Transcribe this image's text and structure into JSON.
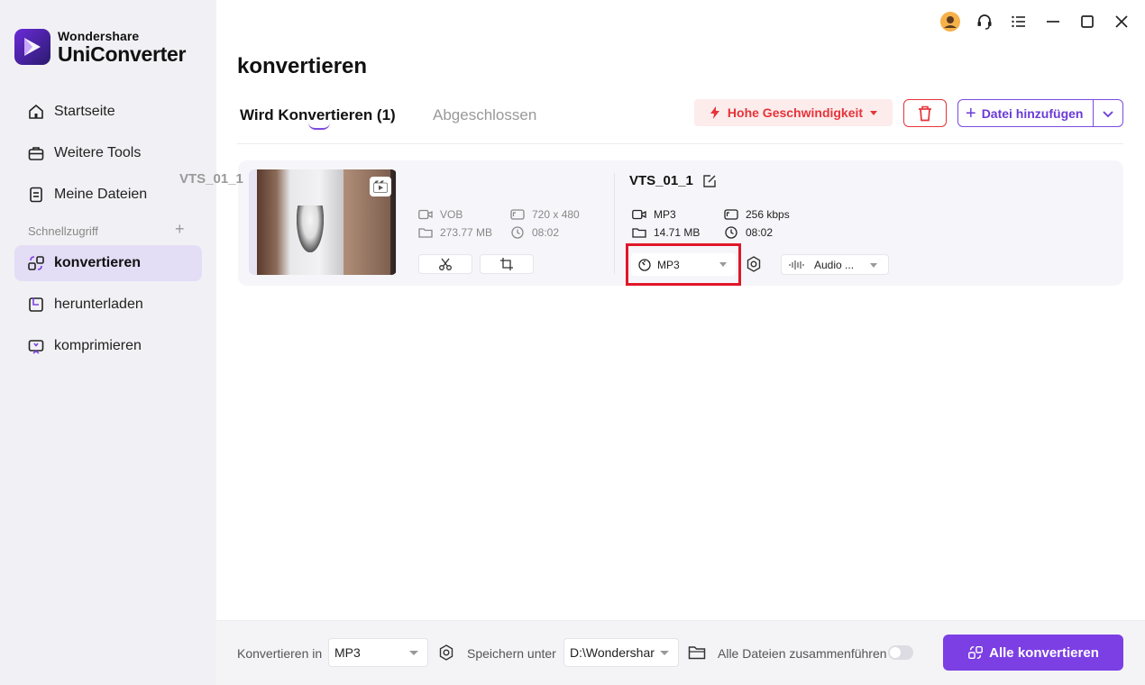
{
  "app": {
    "brand": "Wondershare",
    "product": "UniConverter"
  },
  "sidebar": {
    "items": [
      {
        "label": "Startseite",
        "icon": "home-icon"
      },
      {
        "label": "Weitere Tools",
        "icon": "toolbox-icon"
      },
      {
        "label": "Meine Dateien",
        "icon": "file-icon"
      }
    ],
    "section_label": "Schnellzugriff",
    "quick_items": [
      {
        "label": "konvertieren",
        "icon": "convert-icon",
        "active": true
      },
      {
        "label": "herunterladen",
        "icon": "download-icon"
      },
      {
        "label": "komprimieren",
        "icon": "compress-icon"
      }
    ]
  },
  "main": {
    "title": "konvertieren",
    "tabs": [
      {
        "label": "Wird Konvertieren (1)",
        "active": true
      },
      {
        "label": "Abgeschlossen",
        "active": false
      }
    ],
    "speed_label": "Hohe Geschwindigkeit",
    "add_file_label": "Datei hinzufügen"
  },
  "file": {
    "source": {
      "name": "VTS_01_1",
      "format": "VOB",
      "size": "273.77 MB",
      "resolution": "720 x 480",
      "duration": "08:02"
    },
    "output": {
      "name": "VTS_01_1",
      "format": "MP3",
      "size": "14.71 MB",
      "bitrate": "256 kbps",
      "duration": "08:02",
      "format_select": "MP3",
      "audio_select": "Audio ..."
    }
  },
  "bottom": {
    "convert_in_label": "Konvertieren in",
    "convert_in_value": "MP3",
    "save_label": "Speichern unter",
    "save_path": "D:\\Wondershar",
    "merge_label": "Alle Dateien zusammenführen",
    "merge_enabled": false,
    "convert_all_label": "Alle konvertieren"
  },
  "colors": {
    "accent": "#7c3fe4",
    "danger": "#e5343a",
    "highlight": "#e0172a"
  }
}
